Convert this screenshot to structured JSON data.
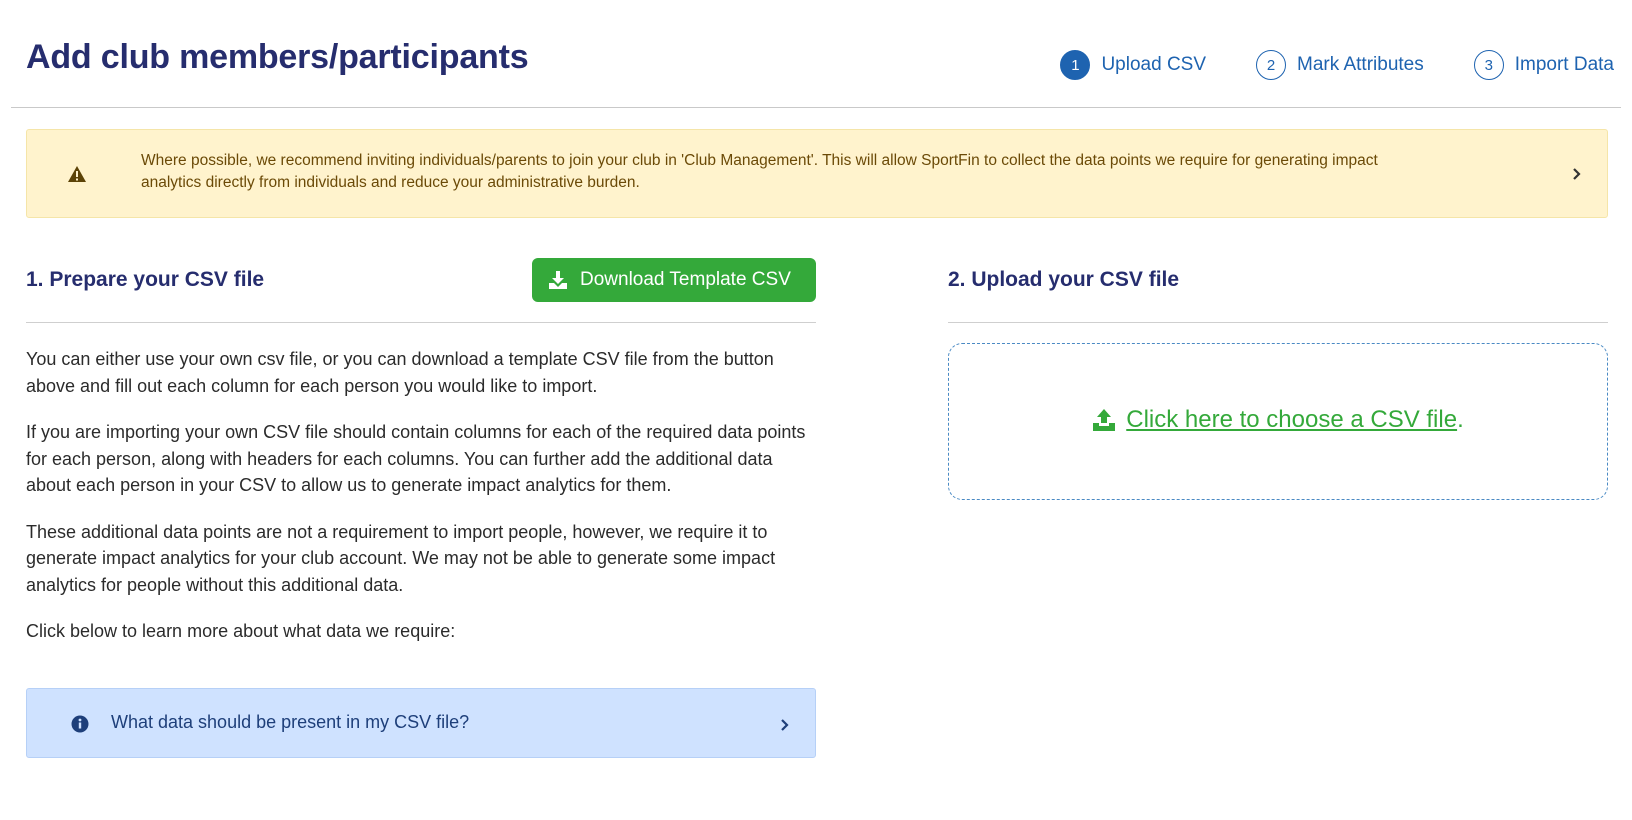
{
  "header": {
    "title": "Add club members/participants",
    "steps": [
      {
        "number": "1",
        "label": "Upload CSV",
        "active": true
      },
      {
        "number": "2",
        "label": "Mark Attributes",
        "active": false
      },
      {
        "number": "3",
        "label": "Import Data",
        "active": false
      }
    ]
  },
  "alert": {
    "icon": "warning-triangle-icon",
    "text": "Where possible, we recommend inviting individuals/parents to join your club in 'Club Management'. This will allow SportFin to collect the data points we require for generating impact analytics directly from individuals and reduce your administrative burden.",
    "color": "#fff3cd"
  },
  "prepare": {
    "title": "1. Prepare your CSV file",
    "download_label": "Download Template CSV",
    "download_icon": "download-icon",
    "paragraphs": [
      "You can either use your own csv file, or you can download a template CSV file from the button above and fill out each column for each person you would like to import.",
      "If you are importing your own CSV file should contain columns for each of the required data points for each person, along with headers for each columns. You can further add the additional data about each person in your CSV to allow us to generate impact analytics for them.",
      "These additional data points are not a requirement to import people, however, we require it to generate impact analytics for your club account. We may not be able to generate some impact analytics for people without this additional data.",
      "Click below to learn more about what data we require:"
    ],
    "info_box": {
      "icon": "info-circle-icon",
      "label": "What data should be present in my CSV file?"
    }
  },
  "upload": {
    "title": "2. Upload your CSV file",
    "link_text": "Click here to choose a CSV file",
    "period": ".",
    "icon": "upload-icon"
  },
  "colors": {
    "title": "#262d6e",
    "accent": "#1e63b0",
    "green": "#34a93a",
    "alert_bg": "#fff3cd",
    "info_bg": "#cfe2ff"
  }
}
